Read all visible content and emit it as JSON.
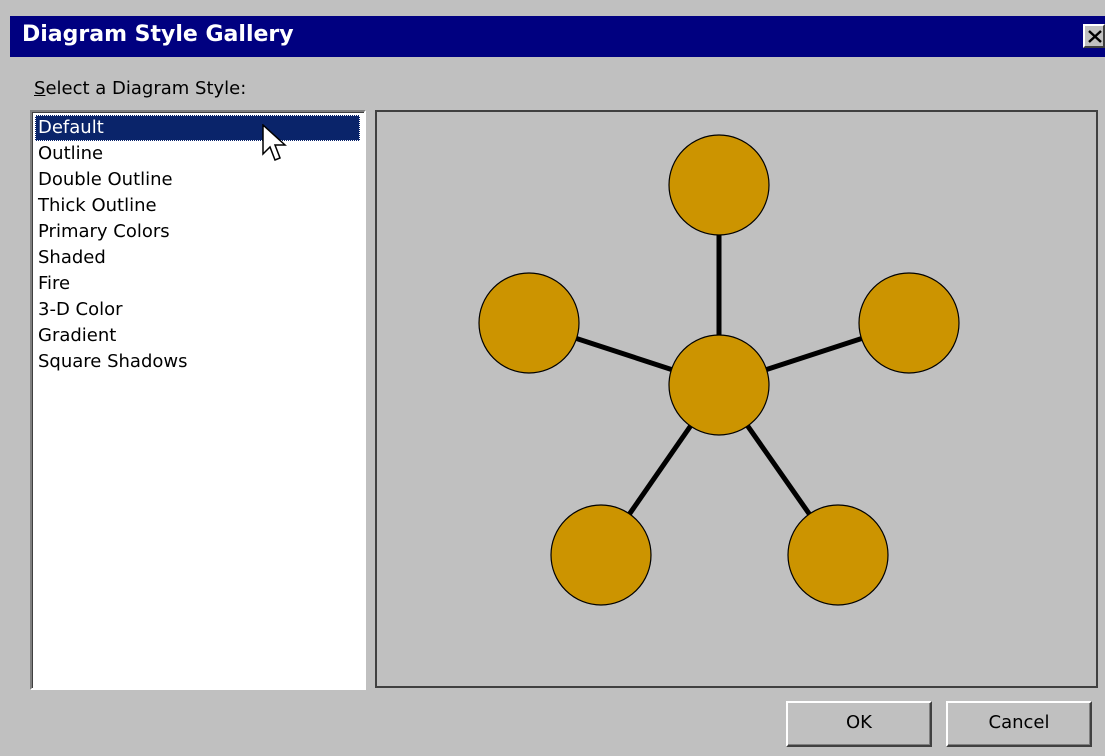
{
  "dialog": {
    "title": "Diagram Style Gallery",
    "close_icon": "close-icon"
  },
  "prompt": {
    "accel": "S",
    "rest": "elect a Diagram Style:"
  },
  "styles": [
    {
      "label": "Default",
      "selected": true
    },
    {
      "label": "Outline",
      "selected": false
    },
    {
      "label": "Double Outline",
      "selected": false
    },
    {
      "label": "Thick Outline",
      "selected": false
    },
    {
      "label": "Primary Colors",
      "selected": false
    },
    {
      "label": "Shaded",
      "selected": false
    },
    {
      "label": "Fire",
      "selected": false
    },
    {
      "label": "3-D Color",
      "selected": false
    },
    {
      "label": "Gradient",
      "selected": false
    },
    {
      "label": "Square Shadows",
      "selected": false
    }
  ],
  "preview": {
    "diagram_type": "radial",
    "node_color": "#cc9400",
    "line_color": "#000000",
    "node_count": 6
  },
  "buttons": {
    "ok": "OK",
    "cancel": "Cancel"
  },
  "colors": {
    "titlebar": "#000080",
    "selection": "#0a246a",
    "face": "#c0c0c0"
  }
}
